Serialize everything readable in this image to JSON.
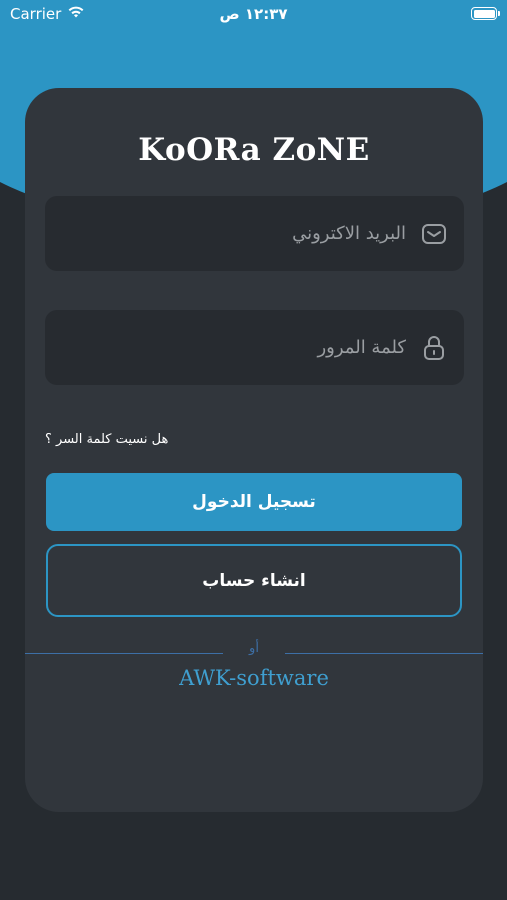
{
  "status_bar": {
    "carrier": "Carrier",
    "time": "١٢:٣٧ ص"
  },
  "app": {
    "title": "KoORa ZoNE"
  },
  "form": {
    "email_placeholder": "البريد الاكتروني",
    "password_placeholder": "كلمة المرور",
    "forgot_password": "هل نسيت كلمة السر ؟",
    "login_label": "تسجيل الدخول",
    "signup_label": "انشاء حساب",
    "divider_text": "أو",
    "footer_brand": "AWK-software"
  },
  "icons": {
    "email": "mail-icon",
    "password": "lock-icon",
    "wifi": "wifi-icon",
    "battery": "battery-icon"
  },
  "colors": {
    "accent": "#2c95c4",
    "background": "#262b30",
    "card": "#31363c",
    "field": "#272b30"
  }
}
